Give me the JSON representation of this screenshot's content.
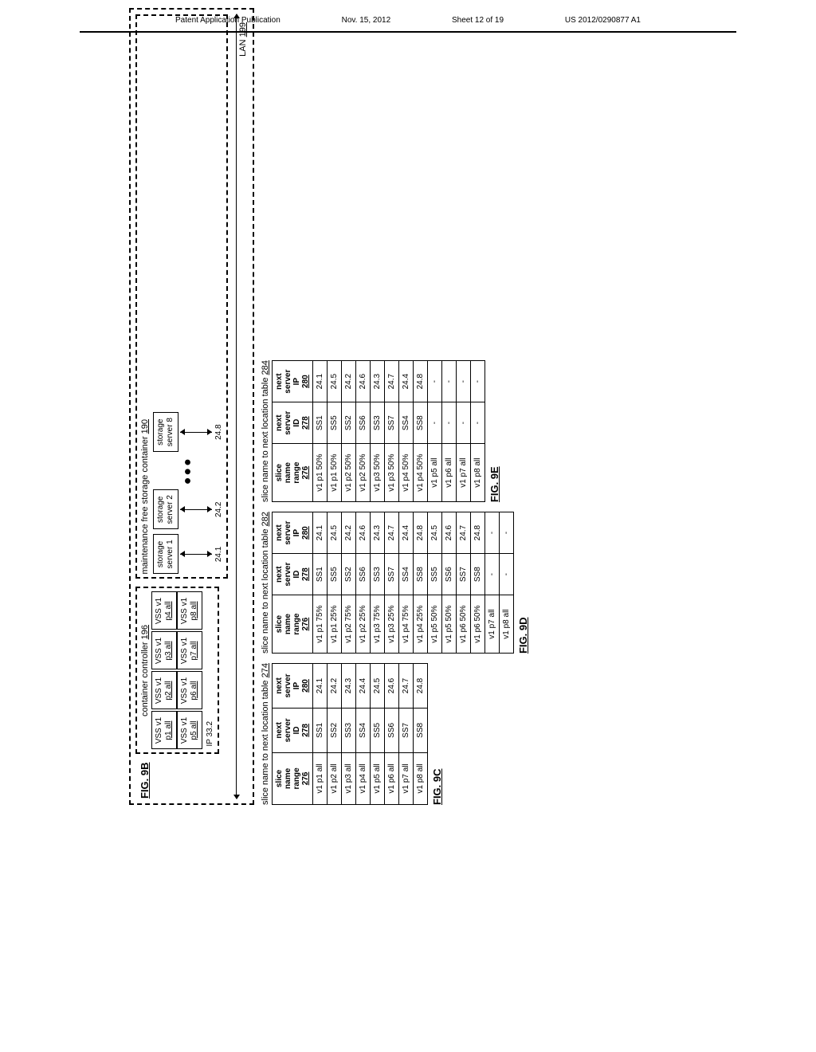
{
  "header": {
    "left": "Patent Application Publication",
    "date": "Nov. 15, 2012",
    "sheet": "Sheet 12 of 19",
    "pubno": "US 2012/0290877 A1"
  },
  "fig9b": {
    "label": "FIG. 9B",
    "controller_title": "container controller",
    "controller_ref": "196",
    "vss": [
      [
        {
          "t": "VSS v1",
          "p": "p1 all"
        },
        {
          "t": "VSS v1",
          "p": "p2 all"
        },
        {
          "t": "VSS v1",
          "p": "p3 all"
        },
        {
          "t": "VSS v1",
          "p": "p4 all"
        }
      ],
      [
        {
          "t": "VSS v1",
          "p": "p5 all"
        },
        {
          "t": "VSS v1",
          "p": "p6 all"
        },
        {
          "t": "VSS v1",
          "p": "p7 all"
        },
        {
          "t": "VSS v1",
          "p": "p8 all"
        }
      ]
    ],
    "ip": "IP 33.2",
    "lan_label": "LAN",
    "lan_ref": "199",
    "storage_title": "maintenance free storage container",
    "storage_ref": "190",
    "servers": [
      {
        "name": "storage server 1",
        "ip": "24.1"
      },
      {
        "name": "storage server 2",
        "ip": "24.2"
      },
      {
        "name": "storage server 8",
        "ip": "24.8"
      }
    ]
  },
  "table9c": {
    "caption": "slice name to next location table",
    "caption_ref": "274",
    "headers": [
      {
        "t": "slice name range",
        "ref": "276"
      },
      {
        "t": "next server ID",
        "ref": "278"
      },
      {
        "t": "next server IP",
        "ref": "280"
      }
    ],
    "rows": [
      [
        "v1 p1 all",
        "SS1",
        "24.1"
      ],
      [
        "v1 p2 all",
        "SS2",
        "24.2"
      ],
      [
        "v1 p3 all",
        "SS3",
        "24.3"
      ],
      [
        "v1 p4 all",
        "SS4",
        "24.4"
      ],
      [
        "v1 p5 all",
        "SS5",
        "24.5"
      ],
      [
        "v1 p6 all",
        "SS6",
        "24.6"
      ],
      [
        "v1 p7 all",
        "SS7",
        "24.7"
      ],
      [
        "v1 p8 all",
        "SS8",
        "24.8"
      ]
    ],
    "fig": "FIG. 9C"
  },
  "table9d": {
    "caption": "slice name to next location table",
    "caption_ref": "282",
    "headers": [
      {
        "t": "slice name range",
        "ref": "276"
      },
      {
        "t": "next server ID",
        "ref": "278"
      },
      {
        "t": "next server IP",
        "ref": "280"
      }
    ],
    "rows": [
      [
        "v1 p1 75%",
        "SS1",
        "24.1"
      ],
      [
        "v1 p1 25%",
        "SS5",
        "24.5"
      ],
      [
        "v1 p2 75%",
        "SS2",
        "24.2"
      ],
      [
        "v1 p2 25%",
        "SS6",
        "24.6"
      ],
      [
        "v1 p3 75%",
        "SS3",
        "24.3"
      ],
      [
        "v1 p3 25%",
        "SS7",
        "24.7"
      ],
      [
        "v1 p4 75%",
        "SS4",
        "24.4"
      ],
      [
        "v1 p4 25%",
        "SS8",
        "24.8"
      ],
      [
        "v1 p5 50%",
        "SS5",
        "24.5"
      ],
      [
        "v1 p5 50%",
        "SS6",
        "24.6"
      ],
      [
        "v1 p6 50%",
        "SS7",
        "24.7"
      ],
      [
        "v1 p6 50%",
        "SS8",
        "24.8"
      ],
      [
        "v1 p7 all",
        "-",
        "-"
      ],
      [
        "v1 p8 all",
        "-",
        "-"
      ]
    ],
    "fig": "FIG. 9D"
  },
  "table9e": {
    "caption": "slice name to next location table",
    "caption_ref": "284",
    "headers": [
      {
        "t": "slice name range",
        "ref": "276"
      },
      {
        "t": "next server ID",
        "ref": "278"
      },
      {
        "t": "next server IP",
        "ref": "280"
      }
    ],
    "rows": [
      [
        "v1 p1 50%",
        "SS1",
        "24.1"
      ],
      [
        "v1 p1 50%",
        "SS5",
        "24.5"
      ],
      [
        "v1 p2 50%",
        "SS2",
        "24.2"
      ],
      [
        "v1 p2 50%",
        "SS6",
        "24.6"
      ],
      [
        "v1 p3 50%",
        "SS3",
        "24.3"
      ],
      [
        "v1 p3 50%",
        "SS7",
        "24.7"
      ],
      [
        "v1 p4 50%",
        "SS4",
        "24.4"
      ],
      [
        "v1 p4 50%",
        "SS8",
        "24.8"
      ],
      [
        "v1 p5 all",
        "-",
        "-"
      ],
      [
        "v1 p6 all",
        "-",
        "-"
      ],
      [
        "v1 p7 all",
        "-",
        "-"
      ],
      [
        "v1 p8 all",
        "-",
        "-"
      ]
    ],
    "fig": "FIG. 9E"
  }
}
